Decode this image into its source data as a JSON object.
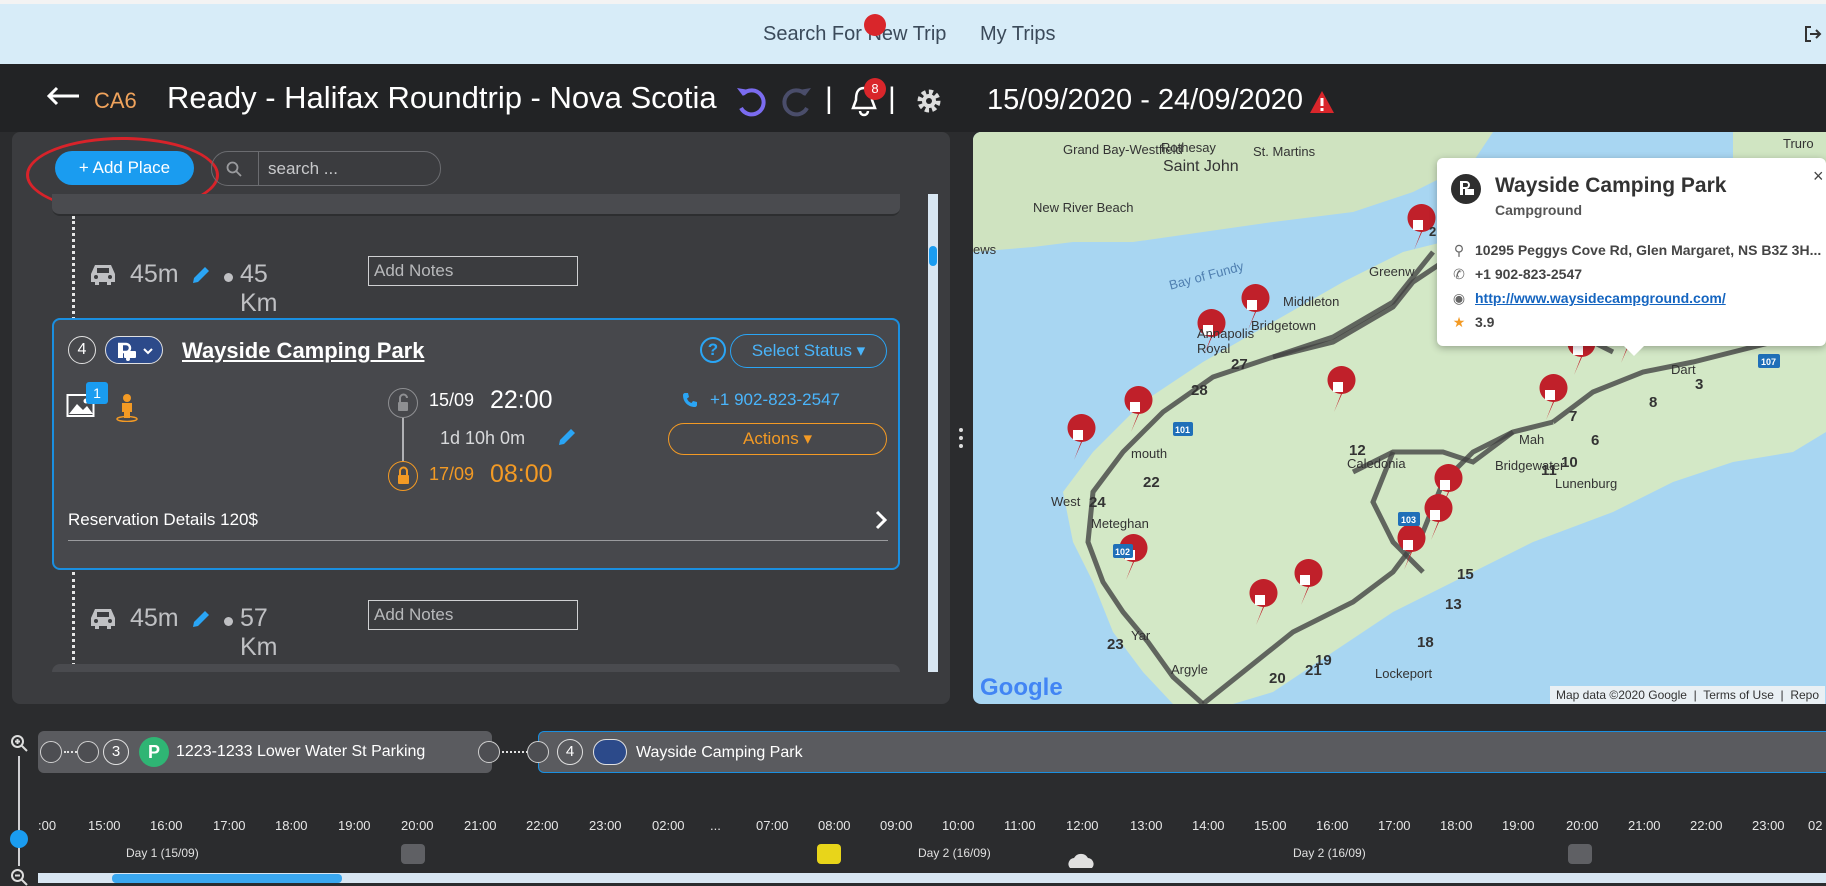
{
  "nav": {
    "search_trip": "Search For New Trip",
    "my_trips": "My Trips"
  },
  "header": {
    "code": "CA6",
    "title": "Ready - Halifax Roundtrip - Nova Scotia",
    "separator": "|",
    "notification_count": "8",
    "dates": "15/09/2020 - 24/09/2020"
  },
  "toolbar": {
    "add_place": "+ Add Place",
    "search_placeholder": "search ..."
  },
  "travel_segments": [
    {
      "duration": "45m",
      "distance": "45 Km",
      "notes_placeholder": "Add Notes"
    },
    {
      "duration": "45m",
      "distance": "57 Km",
      "notes_placeholder": "Add Notes"
    }
  ],
  "place_card": {
    "number": "4",
    "name": "Wayside Camping Park",
    "help": "?",
    "status_label": "Select Status ▾",
    "image_count": "1",
    "start_date": "15/09",
    "start_time": "22:00",
    "duration": "1d 10h 0m",
    "end_date": "17/09",
    "end_time": "08:00",
    "phone": "+1 902-823-2547",
    "actions_label": "Actions ▾",
    "reservation": "Reservation Details  120$"
  },
  "map": {
    "popup": {
      "name": "Wayside Camping Park",
      "type": "Campground",
      "address": "10295 Peggys Cove Rd, Glen Margaret, NS B3Z 3H...",
      "phone": "+1 902-823-2547",
      "website": "http://www.waysidecampground.com/",
      "rating": "3.9",
      "close": "×"
    },
    "labels": [
      "Saint John",
      "Grand Bay-Westfield",
      "Rothesay",
      "St. Martins",
      "New River Beach",
      "Bay of Fundy",
      "Bridgetown",
      "Middleton",
      "Lunenburg",
      "Lockeport",
      "Argyle",
      "Meteghan",
      "Truro",
      "ews",
      "Greenw",
      "Annapolis Royal",
      "Caledonia",
      "Bridgewater",
      "Mah",
      "Dart",
      "Yar",
      "West",
      "mouth"
    ],
    "markers": [
      "2",
      "3",
      "6",
      "7",
      "8",
      "10",
      "11",
      "12",
      "13",
      "15",
      "18",
      "19",
      "20",
      "21",
      "22",
      "23",
      "24",
      "27",
      "28"
    ],
    "route_labels": [
      "101",
      "103",
      "107",
      "102"
    ],
    "footer": {
      "data": "Map data ©2020 Google",
      "terms": "Terms of Use",
      "report": "Repo"
    },
    "google": "Google"
  },
  "timeline": {
    "items": [
      {
        "number": "3",
        "label": "1223-1233 Lower Water St Parking"
      },
      {
        "number": "4",
        "label": "Wayside Camping Park"
      }
    ],
    "hours": [
      ":00",
      "15:00",
      "16:00",
      "17:00",
      "18:00",
      "19:00",
      "20:00",
      "21:00",
      "22:00",
      "23:00",
      "02:00",
      "...",
      "07:00",
      "08:00",
      "09:00",
      "10:00",
      "11:00",
      "12:00",
      "13:00",
      "14:00",
      "15:00",
      "16:00",
      "17:00",
      "18:00",
      "19:00",
      "20:00",
      "21:00",
      "22:00",
      "23:00",
      "02"
    ],
    "days": [
      "Day 1 (15/09)",
      "Day 2 (16/09)",
      "Day 2 (16/09)"
    ]
  },
  "colors": {
    "accent_blue": "#1a9cf0",
    "orange": "#f39a24",
    "marker_red": "#c0202a",
    "header_bg": "#222325"
  }
}
